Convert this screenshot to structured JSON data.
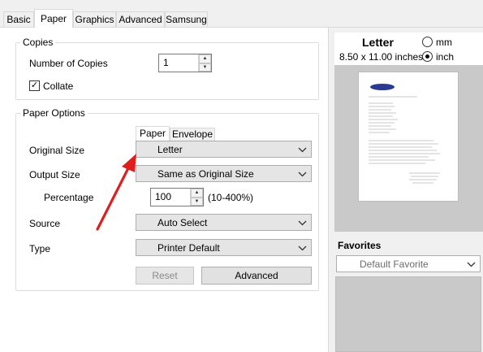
{
  "tabs": [
    {
      "label": "Basic"
    },
    {
      "label": "Paper"
    },
    {
      "label": "Graphics"
    },
    {
      "label": "Advanced"
    },
    {
      "label": "Samsung"
    }
  ],
  "copies": {
    "group_label": "Copies",
    "number_label": "Number of Copies",
    "number_value": "1",
    "collate_label": "Collate",
    "collate_checked": true
  },
  "paper_options": {
    "group_label": "Paper Options",
    "subtabs": [
      {
        "label": "Paper"
      },
      {
        "label": "Envelope"
      }
    ],
    "original_size_label": "Original Size",
    "original_size_value": "Letter",
    "output_size_label": "Output Size",
    "output_size_value": "Same as Original Size",
    "percentage_label": "Percentage",
    "percentage_value": "100",
    "percentage_range": "(10-400%)",
    "source_label": "Source",
    "source_value": "Auto Select",
    "type_label": "Type",
    "type_value": "Printer Default",
    "reset_label": "Reset",
    "advanced_label": "Advanced"
  },
  "preview": {
    "paper_name": "Letter",
    "dimensions": "8.50 x 11.00 inches",
    "unit_mm": "mm",
    "unit_inch": "inch",
    "selected_unit": "inch",
    "page_logo": "SAMSUNG"
  },
  "favorites": {
    "label": "Favorites",
    "selected": "Default Favorite"
  },
  "colors": {
    "annotation_arrow": "#e01e1e",
    "tab_border": "#d9d9d9"
  }
}
